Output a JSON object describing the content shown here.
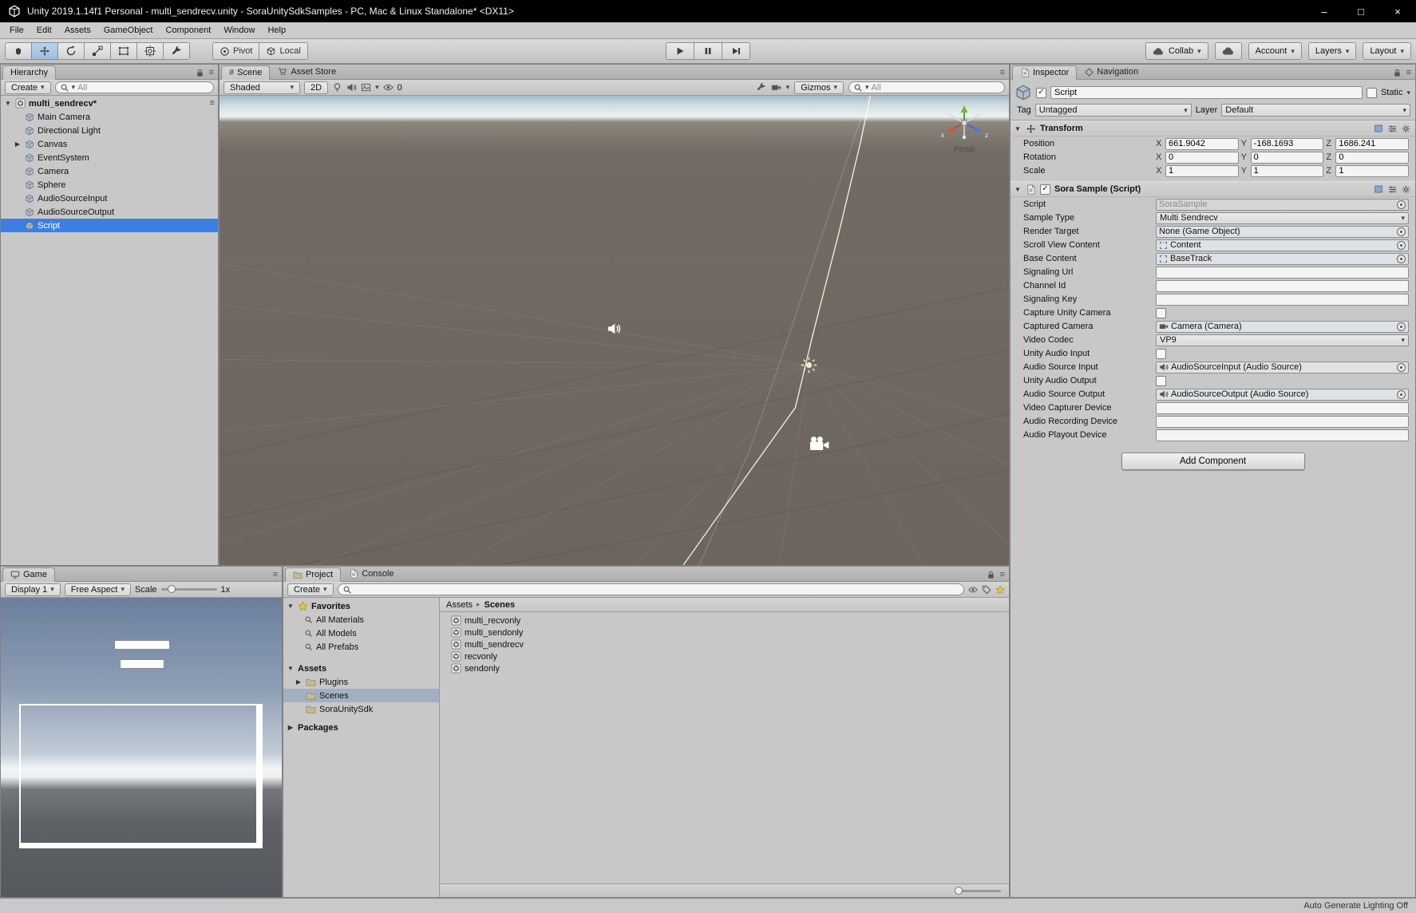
{
  "title_bar": {
    "title": "Unity 2019.1.14f1 Personal - multi_sendrecv.unity - SoraUnitySdkSamples - PC, Mac & Linux Standalone* <DX11>",
    "minimize": "–",
    "maximize": "□",
    "close": "×"
  },
  "menu_bar": {
    "items": [
      "File",
      "Edit",
      "Assets",
      "GameObject",
      "Component",
      "Window",
      "Help"
    ]
  },
  "toolbar": {
    "pivot": "Pivot",
    "local": "Local",
    "collab": "Collab",
    "account": "Account",
    "layers": "Layers",
    "layout": "Layout"
  },
  "hierarchy": {
    "tab": "Hierarchy",
    "create": "Create",
    "search_filter": "All",
    "scene_row": "multi_sendrecv*",
    "items": [
      {
        "label": "Main Camera"
      },
      {
        "label": "Directional Light"
      },
      {
        "label": "Canvas"
      },
      {
        "label": "EventSystem"
      },
      {
        "label": "Camera"
      },
      {
        "label": "Sphere"
      },
      {
        "label": "AudioSourceInput"
      },
      {
        "label": "AudioSourceOutput"
      },
      {
        "label": "Script"
      }
    ]
  },
  "scene": {
    "tab": "Scene",
    "tab_asset_store": "Asset Store",
    "draw_mode": "Shaded",
    "toggle_2d": "2D",
    "hidden_count": "0",
    "gizmos": "Gizmos",
    "search_filter": "All",
    "projection": "Persp",
    "axis_labels": {
      "x": "x",
      "y": "y",
      "z": "z"
    }
  },
  "game": {
    "tab": "Game",
    "display": "Display 1",
    "aspect": "Free Aspect",
    "scale_label": "Scale",
    "scale_value": "1x"
  },
  "project": {
    "tab": "Project",
    "tab_console": "Console",
    "create": "Create",
    "favorites_label": "Favorites",
    "favorites": [
      {
        "label": "All Materials"
      },
      {
        "label": "All Models"
      },
      {
        "label": "All Prefabs"
      }
    ],
    "assets_label": "Assets",
    "folders": [
      {
        "label": "Plugins"
      },
      {
        "label": "Scenes"
      },
      {
        "label": "SoraUnitySdk"
      }
    ],
    "packages_label": "Packages",
    "breadcrumb_root": "Assets",
    "breadcrumb_sep": "▸",
    "breadcrumb_current": "Scenes",
    "files": [
      {
        "label": "multi_recvonly"
      },
      {
        "label": "multi_sendonly"
      },
      {
        "label": "multi_sendrecv"
      },
      {
        "label": "recvonly"
      },
      {
        "label": "sendonly"
      }
    ]
  },
  "inspector": {
    "tab": "Inspector",
    "tab_navigation": "Navigation",
    "enabled": true,
    "name": "Script",
    "static_label": "Static",
    "static_checked": false,
    "tag_label": "Tag",
    "tag_value": "Untagged",
    "layer_label": "Layer",
    "layer_value": "Default",
    "transform": {
      "title": "Transform",
      "axis": {
        "x": "X",
        "y": "Y",
        "z": "Z"
      },
      "rows": [
        {
          "label": "Position",
          "x": "661.9042",
          "y": "-168.1693",
          "z": "1686.241"
        },
        {
          "label": "Rotation",
          "x": "0",
          "y": "0",
          "z": "0"
        },
        {
          "label": "Scale",
          "x": "1",
          "y": "1",
          "z": "1"
        }
      ]
    },
    "sora": {
      "title": "Sora Sample (Script)",
      "enabled": true,
      "fields": [
        {
          "label": "Script",
          "value": "SoraSample",
          "type": "object-disabled"
        },
        {
          "label": "Sample Type",
          "value": "Multi Sendrecv",
          "type": "popup"
        },
        {
          "label": "Render Target",
          "value": "None (Game Object)",
          "type": "object"
        },
        {
          "label": "Scroll View Content",
          "value": "Content",
          "type": "object"
        },
        {
          "label": "Base Content",
          "value": "BaseTrack",
          "type": "object"
        },
        {
          "label": "Signaling Url",
          "value": "",
          "type": "text"
        },
        {
          "label": "Channel Id",
          "value": "",
          "type": "text"
        },
        {
          "label": "Signaling Key",
          "value": "",
          "type": "text"
        },
        {
          "label": "Capture Unity Camera",
          "value": false,
          "type": "checkbox"
        },
        {
          "label": "Captured Camera",
          "value": "Camera (Camera)",
          "type": "object"
        },
        {
          "label": "Video Codec",
          "value": "VP9",
          "type": "popup"
        },
        {
          "label": "Unity Audio Input",
          "value": false,
          "type": "checkbox"
        },
        {
          "label": "Audio Source Input",
          "value": "AudioSourceInput (Audio Source)",
          "type": "object"
        },
        {
          "label": "Unity Audio Output",
          "value": false,
          "type": "checkbox"
        },
        {
          "label": "Audio Source Output",
          "value": "AudioSourceOutput (Audio Source)",
          "type": "object"
        },
        {
          "label": "Video Capturer Device",
          "value": "",
          "type": "text"
        },
        {
          "label": "Audio Recording Device",
          "value": "",
          "type": "text"
        },
        {
          "label": "Audio Playout Device",
          "value": "",
          "type": "text"
        }
      ]
    },
    "add_component": "Add Component"
  },
  "status_bar": {
    "lighting": "Auto Generate Lighting Off"
  },
  "colors": {
    "selection_blue": "#3d7fe1",
    "axis_x_red": "#c24b3a",
    "axis_y_green": "#6fba3c",
    "axis_z_blue": "#3a6fc4"
  }
}
